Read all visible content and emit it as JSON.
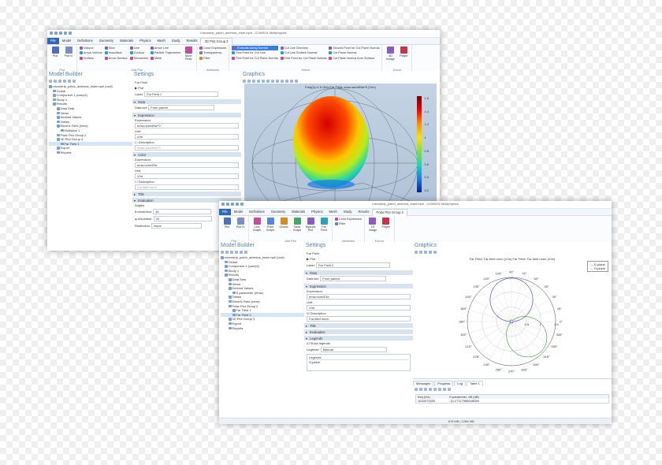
{
  "win1": {
    "title": "microstrip_patch_antenna_inset.mph - COMSOL Multiphysics",
    "menu": [
      "File",
      "Model",
      "Definitions",
      "Geometry",
      "Materials",
      "Physics",
      "Mesh",
      "Study",
      "Results",
      "3D Plot Group 3"
    ],
    "ribbon": {
      "plot": "Plot",
      "plot_in": "Plot In",
      "group_plot": "Plot",
      "col1": [
        "Volume",
        "Arrow Volume",
        "Surface"
      ],
      "col2": [
        "Slice",
        "Isosurface",
        "Arrow Surface"
      ],
      "col3": [
        "Line",
        "Contour",
        "Streamline"
      ],
      "col4": [
        "Arrow Line",
        "Particle Trajectories",
        "Mesh"
      ],
      "group_add": "Add Plot",
      "more_plots": "More Plots",
      "attr": [
        "Color Expression",
        "Transparency",
        "Filter"
      ],
      "group_attr": "Attributes",
      "select_col1": [
        "Evaluate Along Normal",
        "First Point for Cut Line",
        "First Point for Cut Plane Normal"
      ],
      "select_col2": [
        "Cut Line Direction",
        "Cut Line Surface Normal",
        "First Point for Cut Plane Normal"
      ],
      "select_col3": [
        "Second Point for Cut Plane Normal",
        "Cut Plane Normal",
        "Cut Plane Normal from Surface"
      ],
      "group_select": "Select",
      "image": "3D Image",
      "player": "Player",
      "group_export": "Export"
    },
    "model_builder": {
      "title": "Model Builder",
      "tree": [
        {
          "label": "microstrip_patch_antenna_inset.mph (root)",
          "d": 0
        },
        {
          "label": "Global",
          "d": 1
        },
        {
          "label": "Component 1 (comp1)",
          "d": 1
        },
        {
          "label": "Study 1",
          "d": 1
        },
        {
          "label": "Results",
          "d": 1
        },
        {
          "label": "Data Sets",
          "d": 2
        },
        {
          "label": "Views",
          "d": 2
        },
        {
          "label": "Derived Values",
          "d": 2
        },
        {
          "label": "Tables",
          "d": 2
        },
        {
          "label": "Electric Field (emw)",
          "d": 2
        },
        {
          "label": "Multislice 1",
          "d": 3
        },
        {
          "label": "Polar Plot Group 2",
          "d": 2
        },
        {
          "label": "3D Plot Group 3",
          "d": 2
        },
        {
          "label": "Far Field 1",
          "d": 3
        },
        {
          "label": "Export",
          "d": 2
        },
        {
          "label": "Reports",
          "d": 2
        }
      ]
    },
    "settings": {
      "title": "Settings",
      "subtitle": "Far Field",
      "plot_btn": "Plot",
      "label_field": "Label:",
      "label_value": "Far Field 1",
      "sec_data": "Data",
      "dataset_label": "Data set:",
      "dataset_value": "From parent",
      "sec_expression": "Expression",
      "expr_label": "Expression:",
      "expr_value": "emw.normEfar*0",
      "unit_label": "Unit:",
      "unit_value": "V/m",
      "description_label": "Description",
      "description_value": "emw.normEfar*0",
      "sec_color": "Color",
      "expr2_value": "emw.normE3e",
      "unit2_value": "V/m",
      "description2_value": "Far-field norm",
      "sec_title": "Title",
      "sec_evaluation": "Evaluation",
      "angles_label": "Angles",
      "theta_label": "θ-resolution:",
      "theta_value": "45",
      "phi_label": "φ-resolution:",
      "phi_value": "20",
      "restriction_label": "Restriction:",
      "restriction_value": "None"
    },
    "graphics": {
      "title": "Graphics",
      "plot_title": "Freq(1)=1.5 GHz  Far Field: emw.normEfar*0 (V/m)",
      "colorbar": [
        "1.6",
        "1.4",
        "1.2",
        "1",
        "0.8",
        "0.6",
        "0.4",
        "0.2"
      ]
    }
  },
  "win2": {
    "title": "microstrip_patch_antenna_inset.mph - COMSOL Multiphysics",
    "menu": [
      "File",
      "Model",
      "Definitions",
      "Geometry",
      "Materials",
      "Physics",
      "Mesh",
      "Study",
      "Results",
      "Polar Plot Group 2"
    ],
    "ribbon": {
      "plot": "Plot",
      "plot_in": "Plot In",
      "group_plot": "Plot",
      "add_btns": [
        "Line Graph",
        "Point Graph",
        "Global",
        "Table Graph",
        "Nyquist Plot",
        "Far Field"
      ],
      "group_add": "Add Plot",
      "attr": [
        "Color Expression",
        "Filter"
      ],
      "group_attr": "Attributes",
      "image": "1D Image",
      "player": "Player",
      "group_export": "Export"
    },
    "model_builder": {
      "title": "Model Builder",
      "tree": [
        {
          "label": "microstrip_patch_antenna_inset.mph (root)",
          "d": 0
        },
        {
          "label": "Global",
          "d": 1
        },
        {
          "label": "Component 1 (comp1)",
          "d": 1
        },
        {
          "label": "Study 1",
          "d": 1
        },
        {
          "label": "Results",
          "d": 1
        },
        {
          "label": "Data Sets",
          "d": 2
        },
        {
          "label": "Views",
          "d": 2
        },
        {
          "label": "Derived Values",
          "d": 2
        },
        {
          "label": "S-parameter (emw)",
          "d": 3
        },
        {
          "label": "Tables",
          "d": 2
        },
        {
          "label": "Electric Field (emw)",
          "d": 2
        },
        {
          "label": "Polar Plot Group 2",
          "d": 2
        },
        {
          "label": "Far Field 1",
          "d": 3
        },
        {
          "label": "Far Field 2",
          "d": 3
        },
        {
          "label": "3D Plot Group 3",
          "d": 2
        },
        {
          "label": "Export",
          "d": 2
        },
        {
          "label": "Reports",
          "d": 2
        }
      ]
    },
    "settings": {
      "title": "Settings",
      "subtitle": "Far Field",
      "plot_btn": "Plot",
      "label_field": "Label:",
      "label_value": "Far Field 2",
      "sec_data": "Data",
      "dataset_label": "Data set:",
      "dataset_value": "From parent",
      "sec_expression": "Expression",
      "expr_label": "Expression:",
      "expr_value": "emw.normE3e",
      "unit_label": "Unit:",
      "unit_value": "V/m",
      "description_label": "Description",
      "description_value": "Far-field norm",
      "sec_title": "Title",
      "sec_evaluation": "Evaluation",
      "sec_legends": "Legends",
      "show_legends": "Show legends",
      "legends_label": "Legends:",
      "legends_value": "Manual",
      "legends_col": "Legends",
      "legend_entry": "H-plane"
    },
    "graphics": {
      "title": "Graphics",
      "plot_title": "Far Field: Far-field norm (V/m)   Far Field: Far-field norm (V/m)",
      "legend": [
        "E-plane",
        "H-plane"
      ],
      "angles": [
        "0°",
        "15°",
        "30°",
        "45°",
        "60°",
        "75°",
        "90°",
        "105°",
        "120°",
        "135°",
        "150°",
        "165°",
        "180°",
        "195°",
        "210°",
        "225°",
        "240°",
        "255°",
        "270°",
        "285°",
        "300°",
        "315°",
        "330°",
        "345°"
      ],
      "radial": [
        "0.5",
        "1",
        "1.5"
      ]
    },
    "messages": {
      "tabs": [
        "Messages",
        "Progress",
        "Log",
        "Table 1"
      ],
      "col1": "freq (Hz)",
      "col2": "S-parameter, dB (dB)",
      "row_freq": "1633070000",
      "row_val": "-14.27117986648058"
    },
    "status": "878 MB | 1268 MB",
    "colors": {
      "eplane": "#3a3acb",
      "hplane": "#3a9a3a",
      "accent": "#2f68b0"
    }
  }
}
